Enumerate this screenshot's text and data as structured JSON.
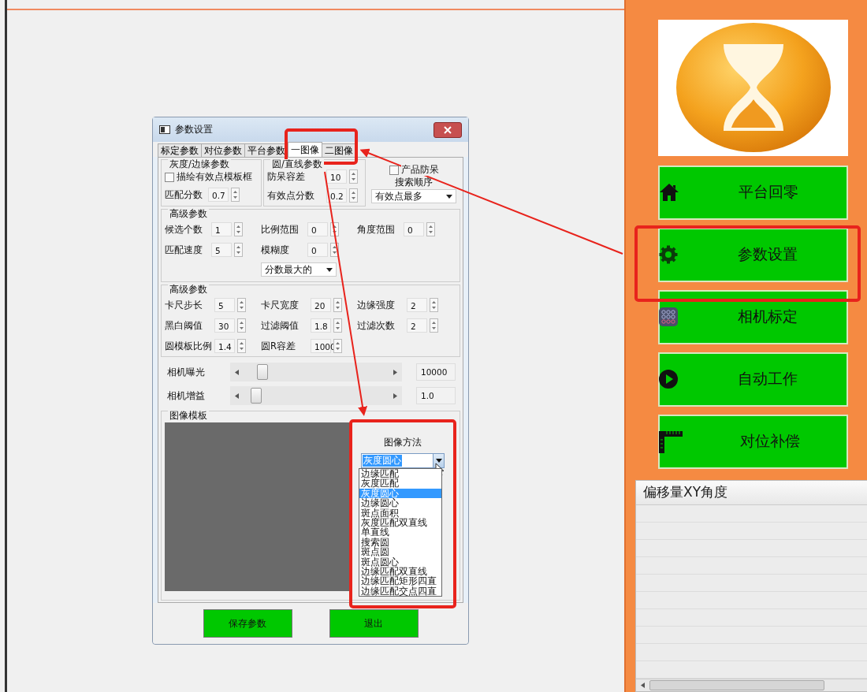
{
  "dialog": {
    "title": "参数设置",
    "tabs": [
      {
        "label": "标定参数",
        "selected": false
      },
      {
        "label": "对位参数",
        "selected": false
      },
      {
        "label": "平台参数",
        "selected": false
      },
      {
        "label": "一图像",
        "selected": true
      },
      {
        "label": "二图像",
        "selected": false
      }
    ],
    "gray_edge_group": {
      "title": "灰度/边缘参数",
      "checkbox": {
        "label": "描绘有效点模板框",
        "checked": false
      },
      "fields": [
        {
          "label": "匹配分数",
          "value": "0.7"
        }
      ]
    },
    "circle_line_group": {
      "title": "圆/直线参数",
      "fields": [
        {
          "label": "防呆容差",
          "value": "10"
        },
        {
          "label": "有效点分数",
          "value": "0.2"
        }
      ]
    },
    "anti_error": {
      "label": "产品防呆",
      "checked": false
    },
    "search_order": {
      "label": "搜索顺序",
      "value": "有效点最多"
    },
    "advanced_1": {
      "title": "高级参数",
      "fields": [
        {
          "label": "候选个数",
          "value": "1"
        },
        {
          "label": "比例范围",
          "value": "0"
        },
        {
          "label": "角度范围",
          "value": "0"
        },
        {
          "label": "匹配速度",
          "value": "5"
        },
        {
          "label": "模糊度",
          "value": "0"
        }
      ],
      "dropdown": "分数最大的"
    },
    "advanced_2": {
      "title": "高级参数",
      "fields": [
        {
          "label": "卡尺步长",
          "value": "5"
        },
        {
          "label": "卡尺宽度",
          "value": "20"
        },
        {
          "label": "边缘强度",
          "value": "2"
        },
        {
          "label": "黑白阈值",
          "value": "30"
        },
        {
          "label": "过滤阈值",
          "value": "1.8"
        },
        {
          "label": "过滤次数",
          "value": "2"
        },
        {
          "label": "圆模板比例",
          "value": "1.4"
        },
        {
          "label": "圆R容差",
          "value": "1000"
        }
      ]
    },
    "sliders": [
      {
        "label": "相机曝光",
        "level": 0.1,
        "value": "10000"
      },
      {
        "label": "相机增益",
        "level": 0.06,
        "value": "1.0"
      }
    ],
    "image_template": {
      "title": "图像模板",
      "method_label": "图像方法",
      "method_value": "灰度圆心",
      "options": [
        {
          "label": "边缘匹配",
          "selected": false
        },
        {
          "label": "灰度匹配",
          "selected": false
        },
        {
          "label": "灰度圆心",
          "selected": true
        },
        {
          "label": "边缘圆心",
          "selected": false
        },
        {
          "label": "斑点面积",
          "selected": false
        },
        {
          "label": "灰度匹配双直线",
          "selected": false
        },
        {
          "label": "单直线",
          "selected": false
        },
        {
          "label": "搜索圆",
          "selected": false
        },
        {
          "label": "斑点圆",
          "selected": false
        },
        {
          "label": "斑点圆心",
          "selected": false
        },
        {
          "label": "边缘匹配双直线",
          "selected": false
        },
        {
          "label": "边缘匹配矩形四直",
          "selected": false
        },
        {
          "label": "边缘匹配交点四直",
          "selected": false
        }
      ]
    },
    "buttons": [
      "保存参数",
      "退出"
    ]
  },
  "nav_buttons": [
    "平台回零",
    "参数设置",
    "相机标定",
    "自动工作",
    "对位补偿"
  ],
  "offset_table": {
    "header": "偏移量XY角度"
  }
}
